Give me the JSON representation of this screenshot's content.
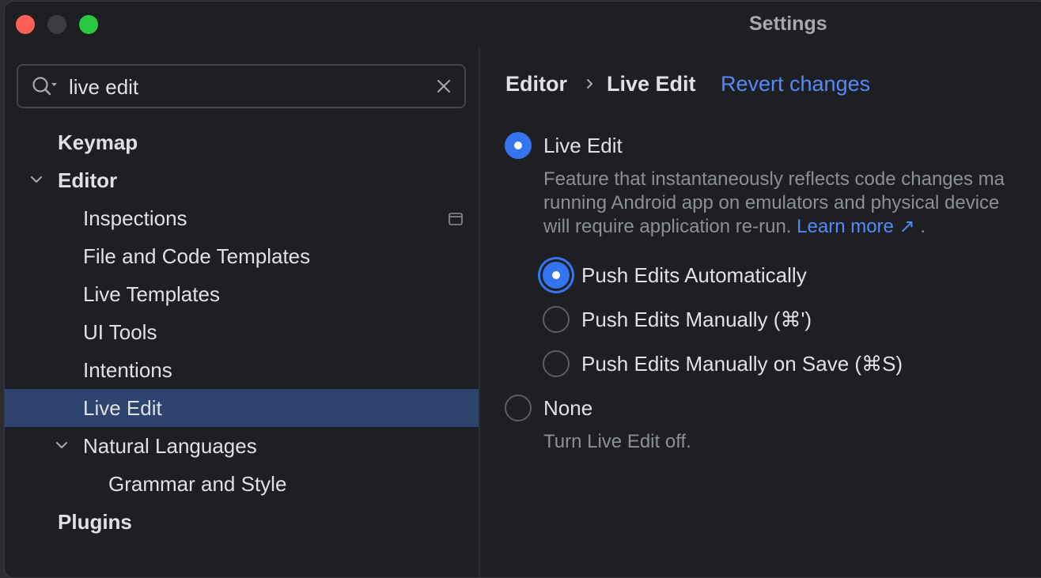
{
  "window": {
    "title": "Settings"
  },
  "search": {
    "value": "live edit"
  },
  "sidebar": {
    "items": [
      {
        "label": "Keymap"
      },
      {
        "label": "Editor"
      },
      {
        "label": "Inspections"
      },
      {
        "label": "File and Code Templates"
      },
      {
        "label": "Live Templates"
      },
      {
        "label": "UI Tools"
      },
      {
        "label": "Intentions"
      },
      {
        "label": "Live Edit"
      },
      {
        "label": "Natural Languages"
      },
      {
        "label": "Grammar and Style"
      },
      {
        "label": "Plugins"
      }
    ],
    "selected": "Live Edit"
  },
  "breadcrumb": {
    "parent": "Editor",
    "current": "Live Edit",
    "revert_label": "Revert changes"
  },
  "options": {
    "live_edit": {
      "label": "Live Edit",
      "selected": true,
      "desc_line1": "Feature that instantaneously reflects code changes ma",
      "desc_line2": "running Android app on emulators and physical device",
      "desc_line3": "will require application re-run.",
      "learn_more": "Learn more ↗",
      "desc_end": "."
    },
    "push_auto": {
      "label": "Push Edits Automatically",
      "selected": true
    },
    "push_manual": {
      "label": "Push Edits Manually (⌘')",
      "selected": false
    },
    "push_save": {
      "label": "Push Edits Manually on Save (⌘S)",
      "selected": false
    },
    "none": {
      "label": "None",
      "selected": false,
      "desc": "Turn Live Edit off."
    }
  },
  "colors": {
    "accent": "#3574f0",
    "link": "#548af7",
    "selection": "#2e436e",
    "background": "#1e1f22"
  }
}
